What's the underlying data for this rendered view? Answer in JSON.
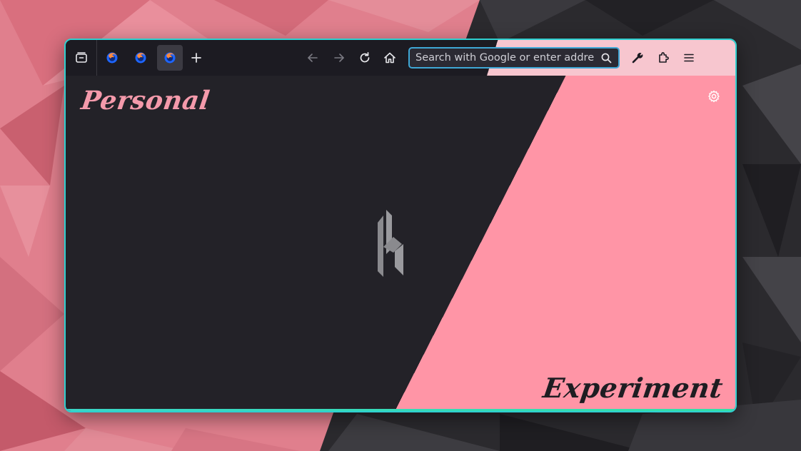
{
  "toolbar": {
    "tabs_overview_icon": "tabs-overview-icon",
    "tabs": [
      {
        "icon": "firefox-icon",
        "active": false
      },
      {
        "icon": "firefox-icon",
        "active": false
      },
      {
        "icon": "firefox-icon",
        "active": true
      }
    ],
    "new_tab_icon": "plus-icon",
    "nav": [
      "back-icon",
      "forward-icon",
      "reload-icon",
      "home-icon"
    ],
    "tools": [
      "wrench-icon",
      "extensions-icon",
      "menu-icon"
    ]
  },
  "urlbar": {
    "placeholder": "Search with Google or enter address",
    "value": ""
  },
  "newtab": {
    "top_left_label": "Personal",
    "bottom_right_label": "Experiment",
    "settings_icon": "gear-icon"
  },
  "colors": {
    "accent_border": "#2fd0d0",
    "pink": "#ff95a6",
    "dark": "#232228",
    "urlbar_focus": "#3fa7d6"
  }
}
